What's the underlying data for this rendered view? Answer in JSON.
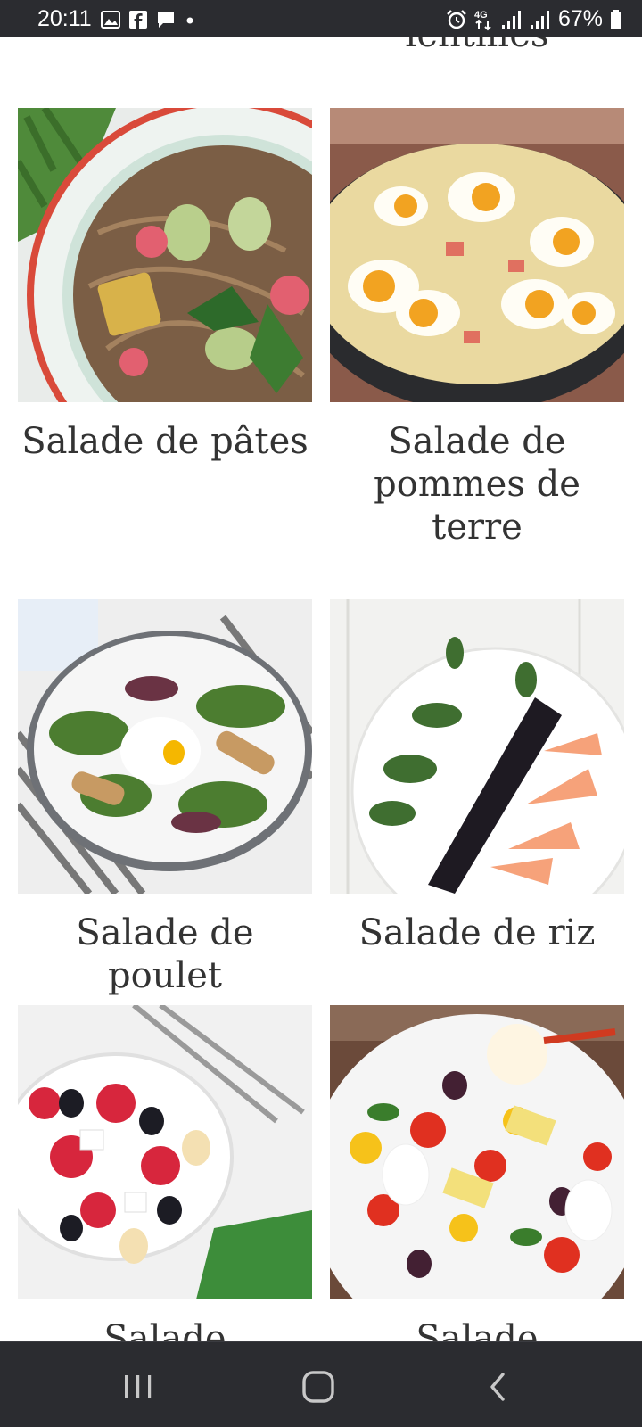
{
  "status_bar": {
    "time": "20:11",
    "notification_icons": [
      "image-icon",
      "facebook-icon",
      "message-icon",
      "dot-icon"
    ],
    "right_icons": [
      "alarm-icon",
      "4g-icon",
      "signal-icon",
      "signal-icon-2"
    ],
    "battery": "67%"
  },
  "recipes": {
    "cut_top_title": "lentilles",
    "cards": [
      {
        "title": "Salade de pâtes",
        "image": "soba-noodle-salad-photo"
      },
      {
        "title": "Salade de pommes de terre",
        "image": "potato-egg-salad-photo"
      },
      {
        "title": "Salade de poulet",
        "image": "chicken-poached-egg-salad-photo"
      },
      {
        "title": "Salade de riz",
        "image": "black-rice-grapefruit-salad-photo"
      },
      {
        "title": "Salade composée",
        "image": "tomato-olive-feta-salad-photo"
      },
      {
        "title": "Salade",
        "image": "mozzarella-tomato-potato-salad-photo"
      }
    ]
  },
  "nav_bar": {
    "buttons": [
      "recent-apps-icon",
      "home-icon",
      "back-icon"
    ]
  }
}
